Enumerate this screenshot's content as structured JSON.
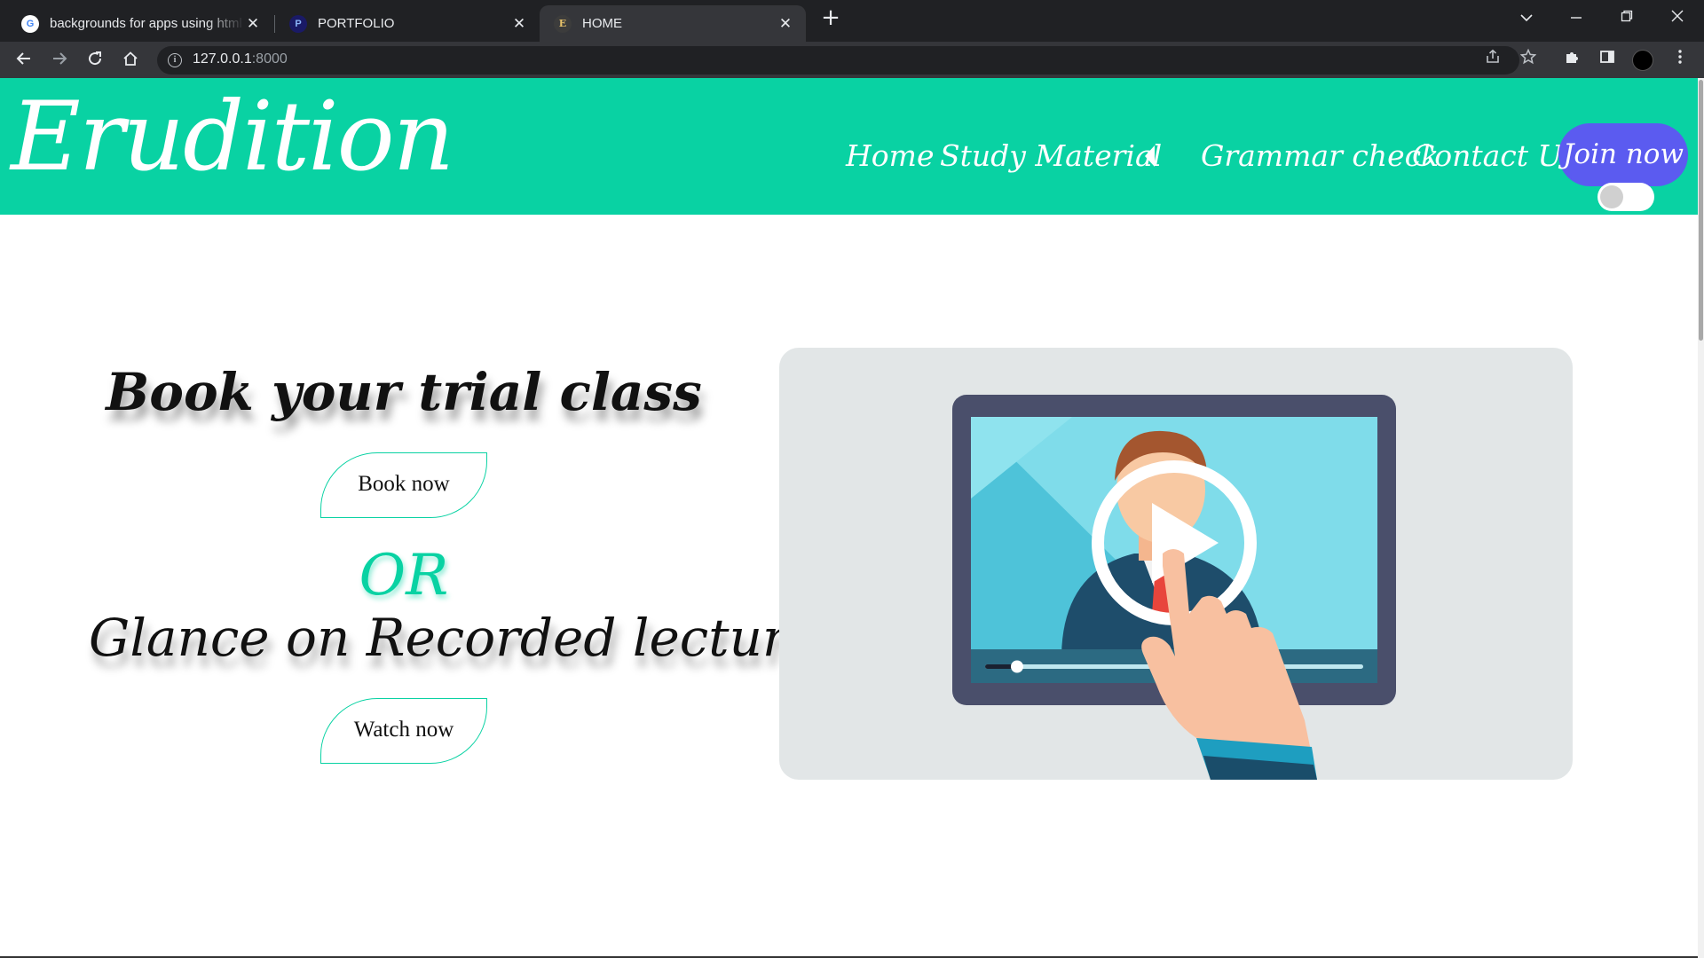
{
  "browser": {
    "tabs": [
      {
        "title": "backgrounds for apps using html",
        "favicon": "google-g-icon",
        "active": false
      },
      {
        "title": "PORTFOLIO",
        "favicon": "portfolio-icon",
        "active": false
      },
      {
        "title": "HOME",
        "favicon": "erudition-e-icon",
        "active": true
      }
    ],
    "address": {
      "host": "127.0.0.1",
      "port": ":8000"
    }
  },
  "site": {
    "logo": "Erudition",
    "nav": {
      "home": "Home",
      "study_material": "Study Material",
      "grammar_check": "Grammar check",
      "contact_us": "Contact Us",
      "join_now": "Join now"
    },
    "theme_toggle": {
      "on": false
    }
  },
  "main": {
    "trial_heading": "Book your trial class",
    "book_button": "Book now",
    "or_text": "OR",
    "lectures_heading": "Glance on Recorded lectures",
    "watch_button": "Watch now",
    "illustration": "video-lecture-illustration"
  },
  "colors": {
    "accent": "#09d2a3",
    "join_button": "#5b5bf0",
    "card_bg": "#e2e6e7"
  }
}
